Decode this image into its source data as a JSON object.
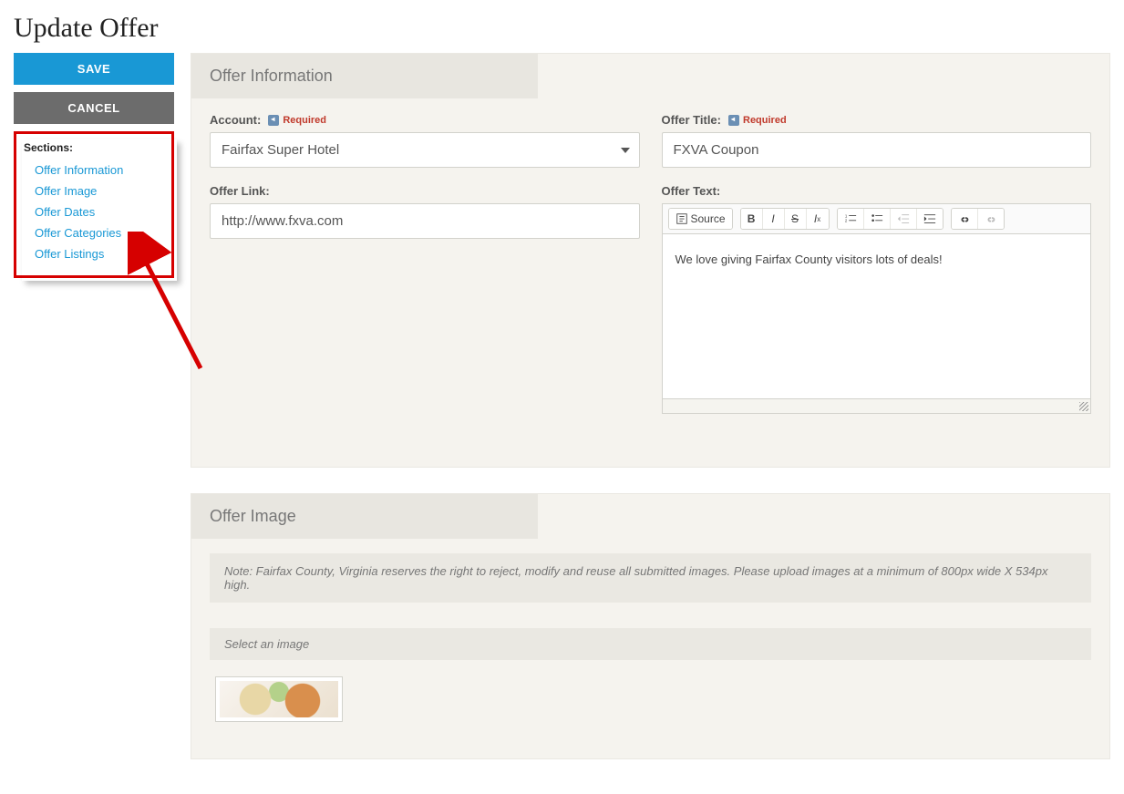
{
  "page": {
    "title": "Update Offer"
  },
  "sidebar": {
    "save_label": "SAVE",
    "cancel_label": "CANCEL",
    "sections_title": "Sections:",
    "sections": [
      {
        "label": "Offer Information"
      },
      {
        "label": "Offer Image"
      },
      {
        "label": "Offer Dates"
      },
      {
        "label": "Offer Categories"
      },
      {
        "label": "Offer Listings"
      }
    ]
  },
  "offer_info": {
    "heading": "Offer Information",
    "account_label": "Account:",
    "account_required": "Required",
    "account_value": "Fairfax Super Hotel",
    "title_label": "Offer Title:",
    "title_required": "Required",
    "title_value": "FXVA Coupon",
    "link_label": "Offer Link:",
    "link_value": "http://www.fxva.com",
    "text_label": "Offer Text:",
    "text_value": "We love giving Fairfax County visitors lots of deals!",
    "toolbar": {
      "source": "Source"
    }
  },
  "offer_image": {
    "heading": "Offer Image",
    "note": "Note: Fairfax County, Virginia reserves the right to reject, modify and reuse all submitted images. Please upload images at a minimum of 800px wide X 534px high.",
    "select_label": "Select an image"
  }
}
